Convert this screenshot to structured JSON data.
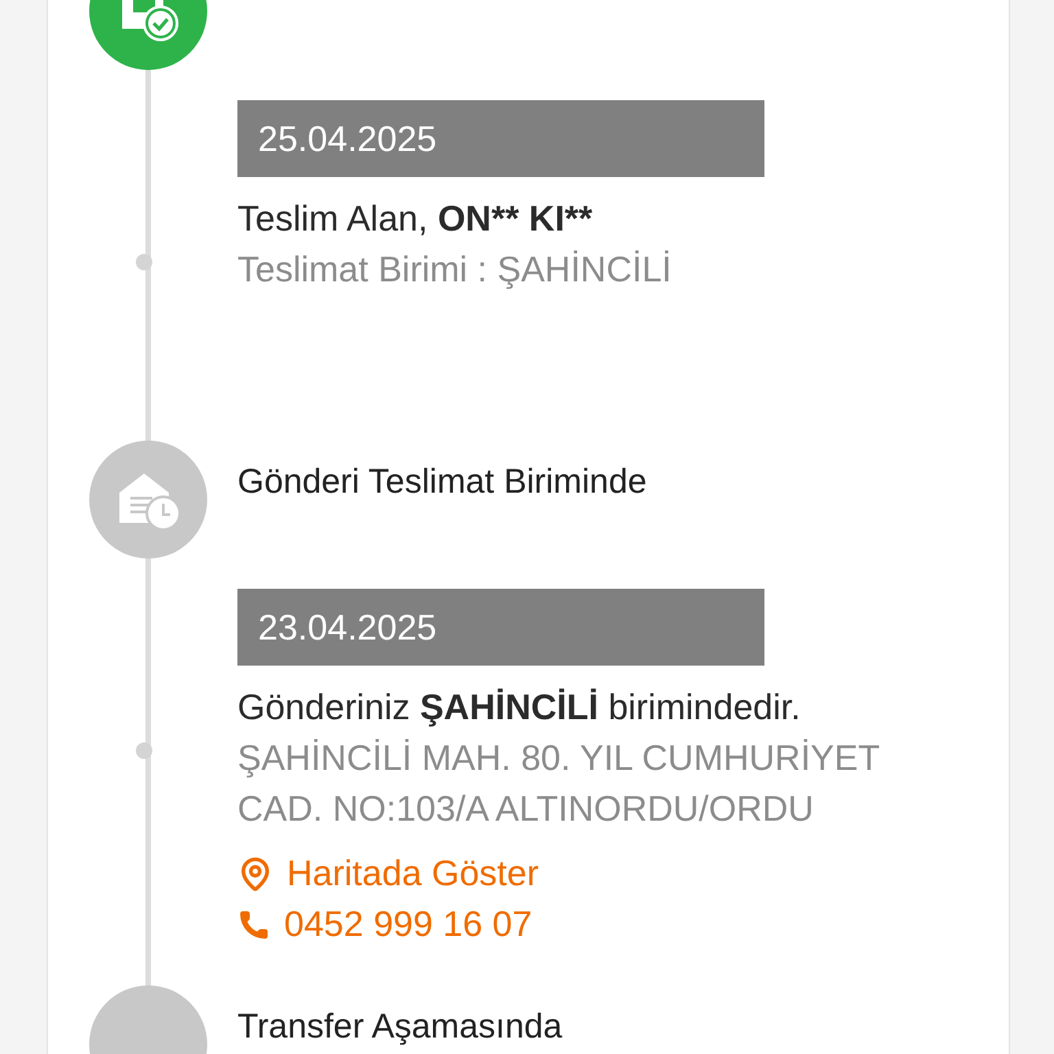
{
  "events": [
    {
      "kind": "delivered",
      "date": "25.04.2025",
      "lines": [
        {
          "kind": "main",
          "text": "Teslim Alan, ",
          "bold": "ON** KI**"
        },
        {
          "kind": "muted",
          "text": "Teslimat Birimi : ŞAHİNCİLİ"
        }
      ]
    },
    {
      "kind": "at_unit",
      "title": "Gönderi Teslimat Biriminde",
      "date": "23.04.2025",
      "lines": [
        {
          "kind": "main",
          "text": "Gönderiniz ",
          "bold": "ŞAHİNCİLİ",
          "after": " birimindedir."
        },
        {
          "kind": "muted",
          "text": "ŞAHİNCİLİ MAH. 80. YIL CUMHURİYET CAD. NO:103/A ALTINORDU/ORDU"
        }
      ],
      "map_link": "Haritada Göster",
      "phone": "0452 999 16 07"
    },
    {
      "kind": "transfer",
      "title": "Transfer Aşamasında"
    }
  ]
}
